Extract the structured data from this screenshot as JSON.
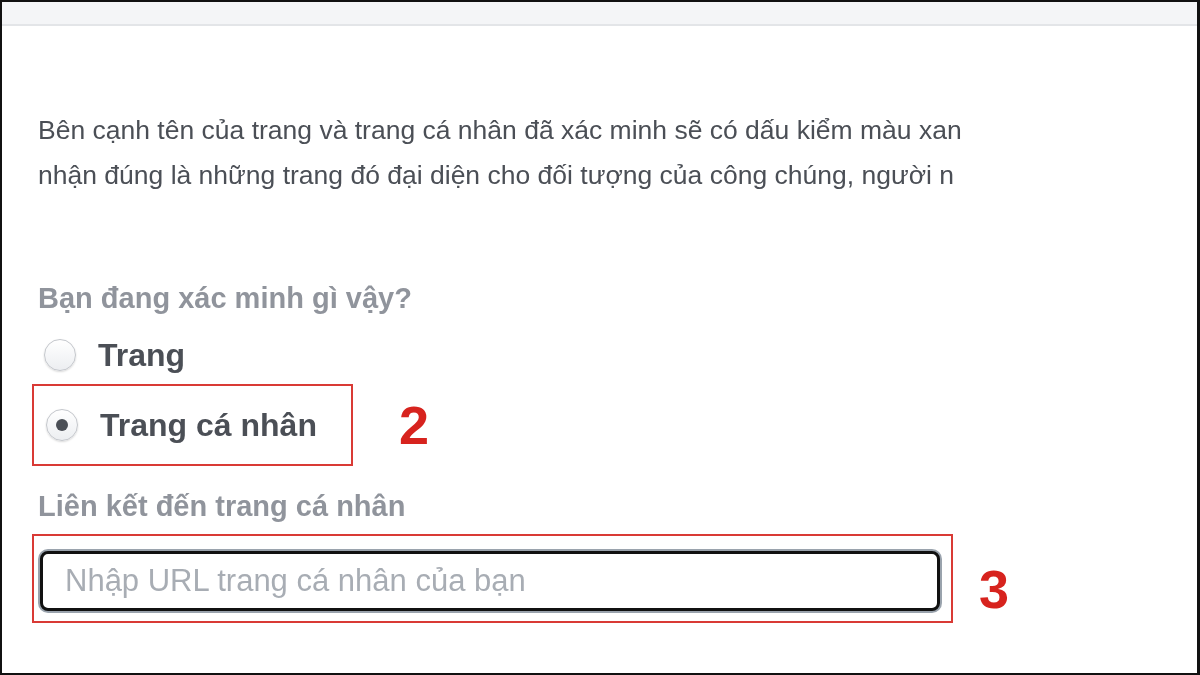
{
  "intro_lines": [
    "Bên cạnh tên của trang và trang cá nhân đã xác minh sẽ có dấu kiểm màu xan",
    "nhận đúng là những trang đó đại diện cho đối tượng của công chúng, người n"
  ],
  "question": "Bạn đang xác minh gì vậy?",
  "options": [
    {
      "label": "Trang",
      "selected": false
    },
    {
      "label": "Trang cá nhân",
      "selected": true,
      "annotation": "2"
    }
  ],
  "link_field": {
    "label": "Liên kết đến trang cá nhân",
    "placeholder": "Nhập URL trang cá nhân của bạn",
    "focused": true,
    "annotation": "3"
  }
}
